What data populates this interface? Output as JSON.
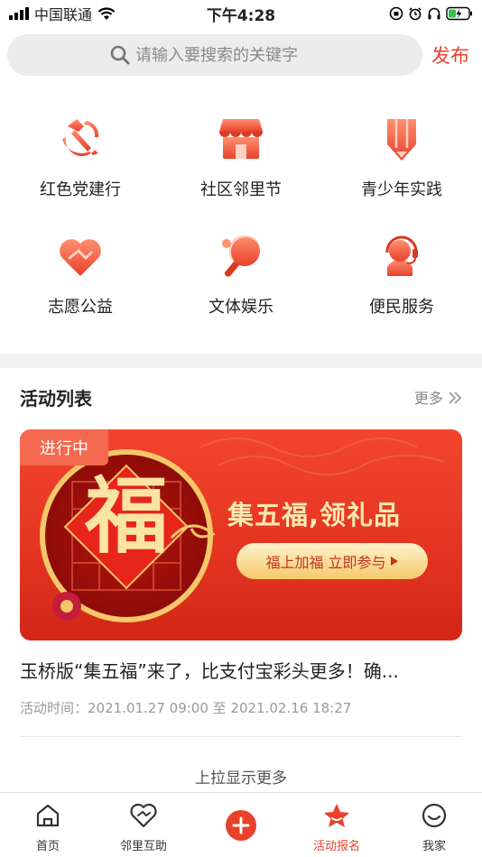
{
  "status_bar": {
    "carrier": "中国联通",
    "time": "下午4:28"
  },
  "search": {
    "placeholder": "请输入要搜索的关键字",
    "publish_label": "发布"
  },
  "categories": [
    {
      "label": "红色党建行",
      "icon": "party-emblem-icon"
    },
    {
      "label": "社区邻里节",
      "icon": "storefront-icon"
    },
    {
      "label": "青少年实践",
      "icon": "pencil-icon"
    },
    {
      "label": "志愿公益",
      "icon": "heart-hands-icon"
    },
    {
      "label": "文体娱乐",
      "icon": "ping-pong-icon"
    },
    {
      "label": "便民服务",
      "icon": "headset-service-icon"
    }
  ],
  "activity": {
    "section_title": "活动列表",
    "more_label": "更多",
    "card": {
      "status": "进行中",
      "banner_char": "福",
      "banner_title": "集五福,领礼品",
      "banner_button": "福上加福 立即参与",
      "name": "玉桥版“集五福”来了，比支付宝彩头更多！确...",
      "time": "活动时间：2021.01.27 09:00 至 2021.02.16 18:27"
    },
    "load_more": "上拉显示更多"
  },
  "tabbar": {
    "items": [
      {
        "label": "首页",
        "icon": "home-icon"
      },
      {
        "label": "邻里互助",
        "icon": "heart-icon"
      },
      {
        "label": "",
        "icon": "plus-icon"
      },
      {
        "label": "活动报名",
        "icon": "star-icon"
      },
      {
        "label": "我家",
        "icon": "smile-icon"
      }
    ]
  },
  "colors": {
    "accent": "#e8412c",
    "icon_gradient_light": "#ff8a6a",
    "icon_gradient_dark": "#e8412c"
  }
}
